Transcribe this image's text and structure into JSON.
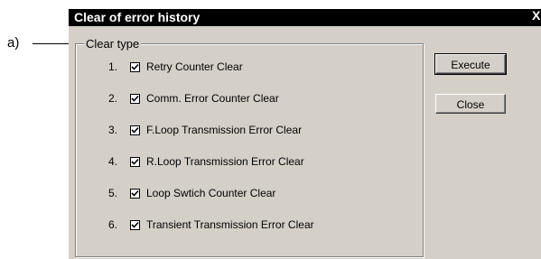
{
  "annotation": {
    "marker": "a)"
  },
  "dialog": {
    "title": "Clear of error history",
    "close_glyph": "X",
    "group_label": "Clear type",
    "items": [
      {
        "num": "1.",
        "label": "Retry Counter Clear",
        "checked": true
      },
      {
        "num": "2.",
        "label": "Comm. Error Counter Clear",
        "checked": true
      },
      {
        "num": "3.",
        "label": "F.Loop Transmission Error Clear",
        "checked": true
      },
      {
        "num": "4.",
        "label": "R.Loop Transmission Error Clear",
        "checked": true
      },
      {
        "num": "5.",
        "label": "Loop Swtich Counter Clear",
        "checked": true
      },
      {
        "num": "6.",
        "label": "Transient Transmission Error Clear",
        "checked": true
      }
    ],
    "buttons": {
      "execute": "Execute",
      "close": "Close"
    }
  },
  "colors": {
    "face": "#d4d0c8",
    "titlebar": "#000000",
    "title_text": "#ffffff"
  }
}
